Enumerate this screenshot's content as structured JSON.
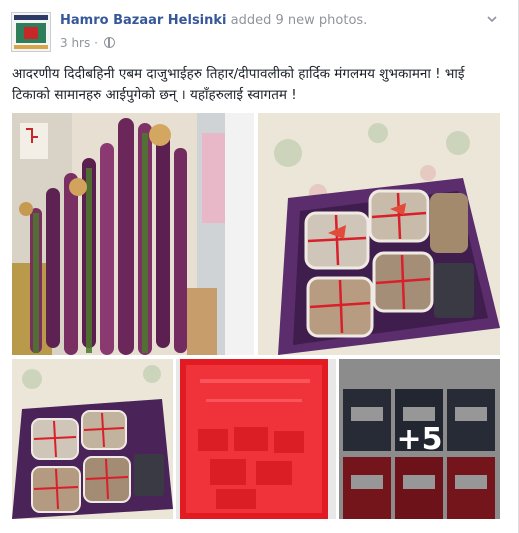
{
  "post": {
    "page_name": "Hamro Bazaar Helsinki",
    "action_text": "added 9 new photos.",
    "timestamp": "3 hrs",
    "separator": "·",
    "body_text": "आदरणीय दिदीबहिनी एबम दाजुभाईहरु तिहार/दीपावलीको हार्दिक मंगलमय शुभकामना ! भाई टिकाको सामानहरु आईपुगेको छन् । यहाँहरुलाई स्वागतम !"
  },
  "photos": {
    "more_count_label": "+5"
  },
  "icons": {
    "audience": "globe-icon",
    "menu": "chevron-down-icon"
  },
  "colors": {
    "link": "#365899",
    "meta": "#90949c",
    "text": "#1d2129"
  }
}
